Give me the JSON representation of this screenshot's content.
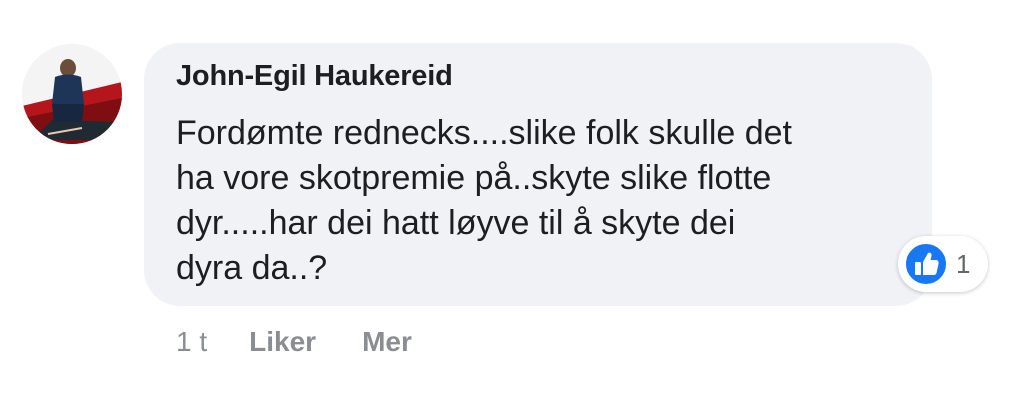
{
  "comment": {
    "author": "John-Egil Haukereid",
    "text_lines": [
      "Fordømte rednecks....slike folk skulle det",
      "ha vore skotpremie på..skyte slike flotte",
      "dyr.....har dei hatt løyve til å skyte dei",
      "dyra da..?"
    ],
    "reaction": {
      "icon": "thumbs-up-icon",
      "count": "1",
      "color": "#1877f2"
    }
  },
  "actions": {
    "time": "1 t",
    "like_label": "Liker",
    "more_label": "Mer"
  },
  "colors": {
    "bubble": "#f0f2f5",
    "text": "#1c1e21",
    "meta": "#8a8d91"
  }
}
